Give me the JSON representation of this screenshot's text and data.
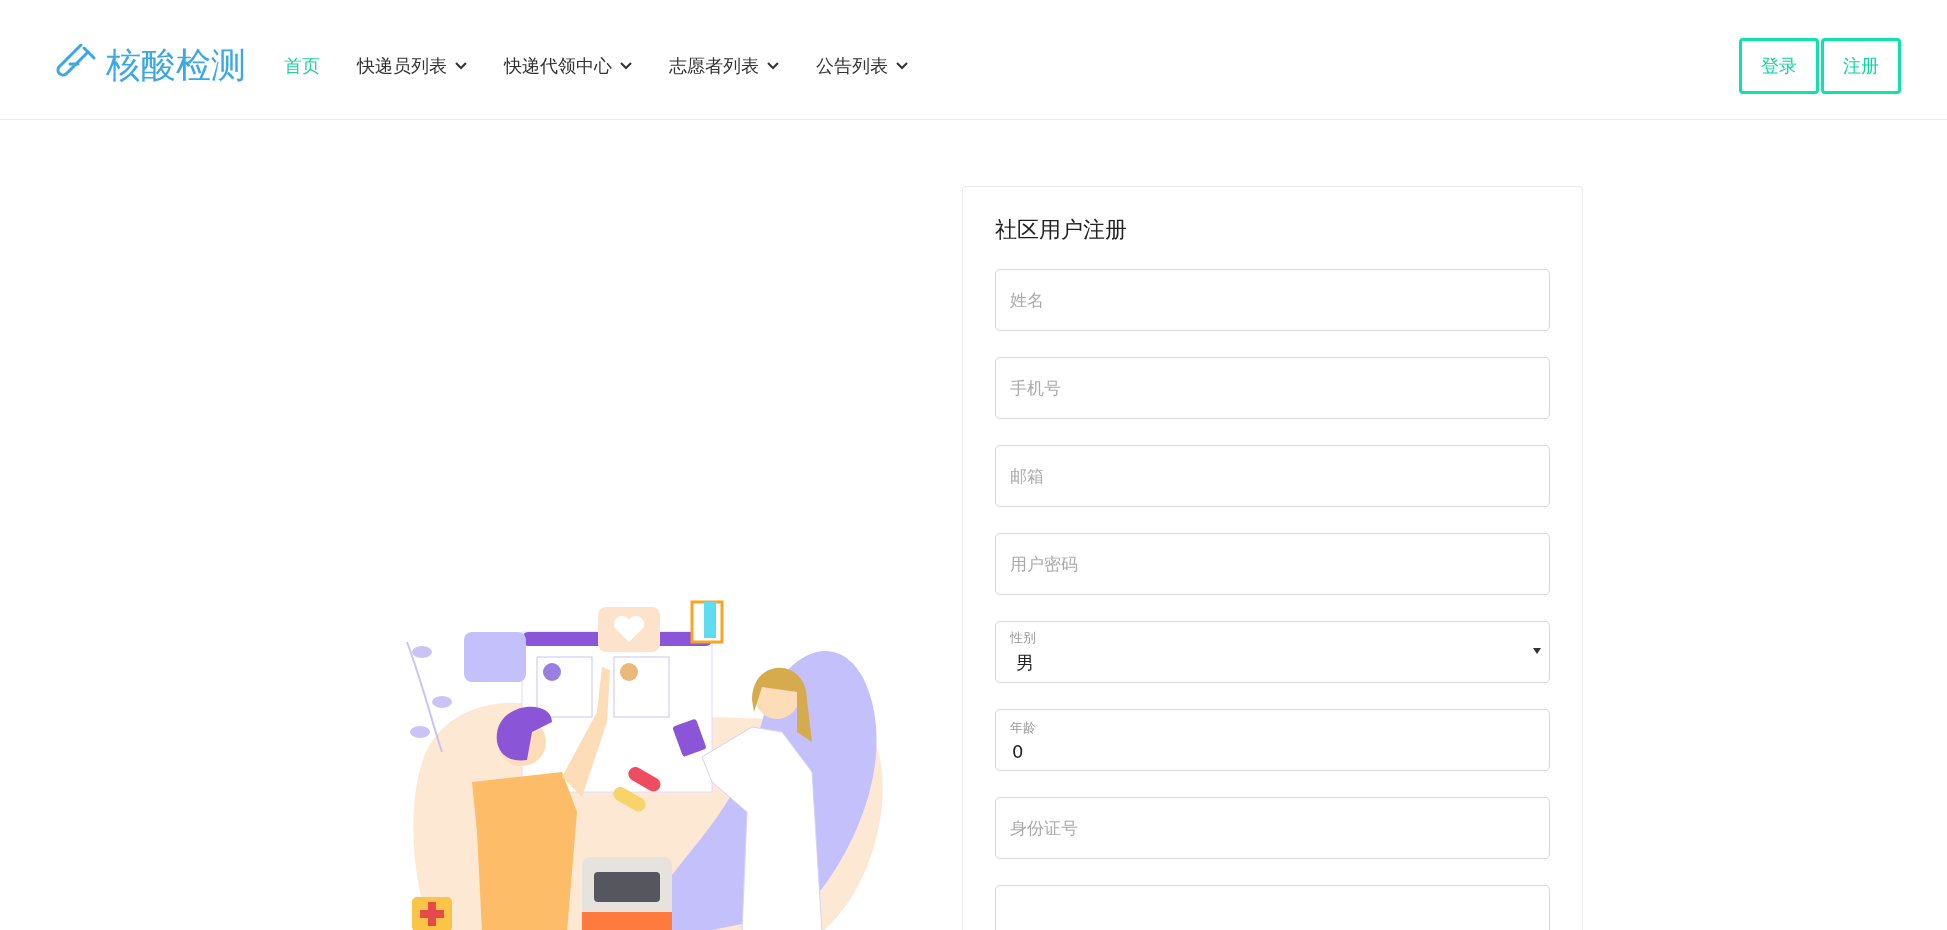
{
  "header": {
    "logo": "核酸检测",
    "nav": [
      {
        "label": "首页",
        "selected": true,
        "dropdown": false
      },
      {
        "label": "快递员列表",
        "selected": false,
        "dropdown": true
      },
      {
        "label": "快递代领中心",
        "selected": false,
        "dropdown": true
      },
      {
        "label": "志愿者列表",
        "selected": false,
        "dropdown": true
      },
      {
        "label": "公告列表",
        "selected": false,
        "dropdown": true
      }
    ],
    "buttons": [
      "登录",
      "注册"
    ]
  },
  "form": {
    "title": "社区用户注册",
    "fields": [
      {
        "kind": "input",
        "placeholder": "姓名"
      },
      {
        "kind": "input",
        "placeholder": "手机号"
      },
      {
        "kind": "input",
        "placeholder": "邮箱"
      },
      {
        "kind": "input",
        "placeholder": "用户密码"
      },
      {
        "kind": "select",
        "label": "性别",
        "value": "男"
      },
      {
        "kind": "labeled",
        "label": "年龄",
        "value": "0"
      },
      {
        "kind": "input",
        "placeholder": "身份证号"
      },
      {
        "kind": "input"
      }
    ]
  }
}
